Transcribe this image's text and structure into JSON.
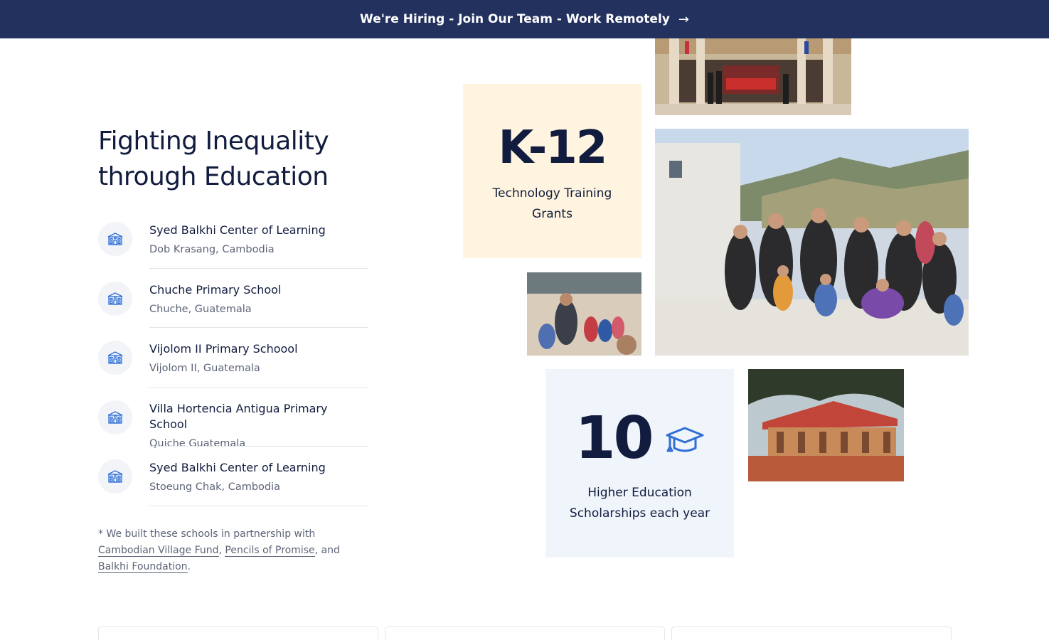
{
  "banner": {
    "text": "We're Hiring - Join Our Team - Work Remotely",
    "arrow": "→"
  },
  "heading": {
    "line1": "Fighting Inequality",
    "line2": "through Education"
  },
  "schools": [
    {
      "name": "Syed Balkhi Center of Learning",
      "location": "Dob Krasang, Cambodia",
      "icon": "school-icon"
    },
    {
      "name": "Chuche Primary School",
      "location": "Chuche, Guatemala",
      "icon": "school-icon"
    },
    {
      "name": "Vijolom II Primary Schoool",
      "location": "Vijolom II, Guatemala",
      "icon": "school-icon"
    },
    {
      "name": "Villa Hortencia Antigua Primary School",
      "location": "Quiche Guatemala",
      "icon": "school-icon"
    },
    {
      "name": "Syed Balkhi Center of Learning",
      "location": "Stoeung Chak, Cambodia",
      "icon": "school-icon"
    }
  ],
  "footnote": {
    "prefix": "* We built these schools in partnership with ",
    "link1": "Cambodian Village Fund",
    "sep1": ", ",
    "link2": "Pencils of Promise",
    "sep2": ", and ",
    "link3": "Balkhi Foundation",
    "suffix": "."
  },
  "stats": {
    "k12": {
      "value": "K-12",
      "line1": "Technology Training",
      "line2": "Grants"
    },
    "scholarships": {
      "value": "10",
      "icon": "graduation-cap-icon",
      "line1": "Higher Education",
      "line2": "Scholarships each year"
    }
  },
  "colors": {
    "banner_bg": "#22315e",
    "heading": "#111c3e",
    "muted": "#5d6478",
    "icon_blue": "#2f6fd6",
    "k12_card_bg": "#fff4df",
    "scholarship_card_bg": "#f0f4fb"
  }
}
